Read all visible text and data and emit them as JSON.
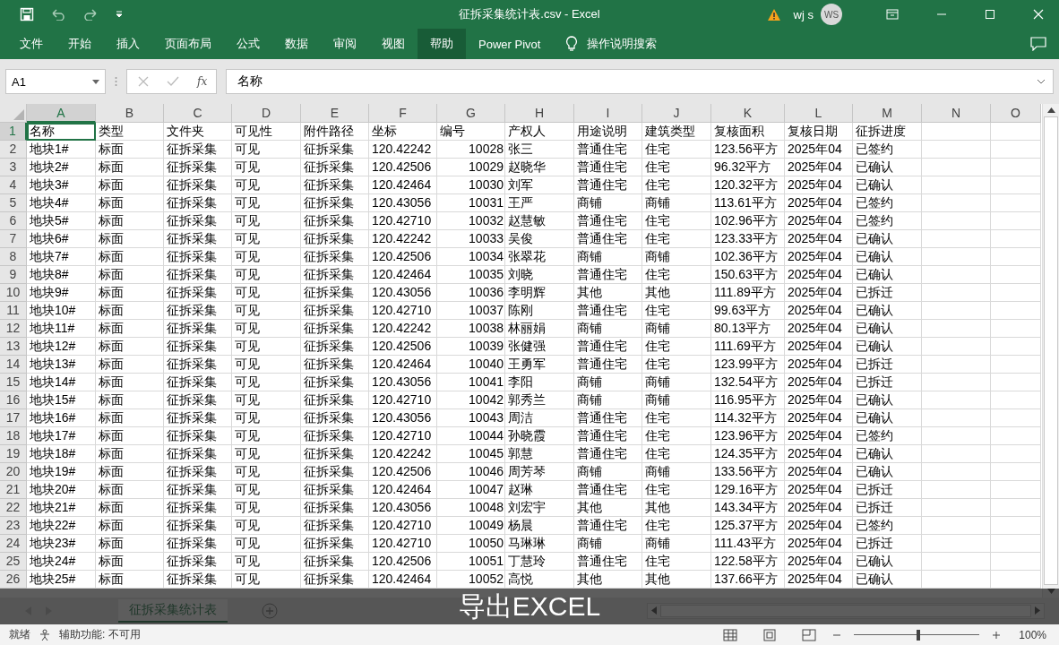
{
  "window": {
    "title": "征拆采集统计表.csv  -  Excel",
    "user": "wj s",
    "avatar": "WS"
  },
  "ribbon_tabs": [
    {
      "label": "文件",
      "selected": false
    },
    {
      "label": "开始",
      "selected": false
    },
    {
      "label": "插入",
      "selected": false
    },
    {
      "label": "页面布局",
      "selected": false
    },
    {
      "label": "公式",
      "selected": false
    },
    {
      "label": "数据",
      "selected": false
    },
    {
      "label": "审阅",
      "selected": false
    },
    {
      "label": "视图",
      "selected": false
    },
    {
      "label": "帮助",
      "selected": true
    },
    {
      "label": "Power Pivot",
      "selected": false
    }
  ],
  "tell_me": "操作说明搜索",
  "formula_bar": {
    "name_box": "A1",
    "function_button": "fx",
    "formula": "名称"
  },
  "columns": [
    {
      "letter": "A",
      "selected": true,
      "kind": "text"
    },
    {
      "letter": "B",
      "selected": false,
      "kind": "text"
    },
    {
      "letter": "C",
      "selected": false,
      "kind": "text"
    },
    {
      "letter": "D",
      "selected": false,
      "kind": "text"
    },
    {
      "letter": "E",
      "selected": false,
      "kind": "text"
    },
    {
      "letter": "F",
      "selected": false,
      "kind": "text"
    },
    {
      "letter": "G",
      "selected": false,
      "kind": "number"
    },
    {
      "letter": "H",
      "selected": false,
      "kind": "text"
    },
    {
      "letter": "I",
      "selected": false,
      "kind": "text"
    },
    {
      "letter": "J",
      "selected": false,
      "kind": "text"
    },
    {
      "letter": "K",
      "selected": false,
      "kind": "text"
    },
    {
      "letter": "L",
      "selected": false,
      "kind": "text"
    },
    {
      "letter": "M",
      "selected": false,
      "kind": "text"
    },
    {
      "letter": "N",
      "selected": false,
      "kind": "text"
    },
    {
      "letter": "O",
      "selected": false,
      "kind": "text"
    }
  ],
  "rows": [
    {
      "number": "1",
      "selected": true,
      "cells": [
        "名称",
        "类型",
        "文件夹",
        "可见性",
        "附件路径",
        "坐标",
        "编号",
        "产权人",
        "用途说明",
        "建筑类型",
        "复核面积",
        "复核日期",
        "征拆进度"
      ]
    },
    {
      "number": "2",
      "selected": false,
      "cells": [
        "地块1#",
        "标面",
        "征拆采集",
        "可见",
        "征拆采集",
        "120.42242",
        "10028",
        "张三",
        "普通住宅",
        "住宅",
        "123.56平方",
        "2025年04",
        "已签约"
      ]
    },
    {
      "number": "3",
      "selected": false,
      "cells": [
        "地块2#",
        "标面",
        "征拆采集",
        "可见",
        "征拆采集",
        "120.42506",
        "10029",
        "赵晓华",
        "普通住宅",
        "住宅",
        "96.32平方",
        "2025年04",
        "已确认"
      ]
    },
    {
      "number": "4",
      "selected": false,
      "cells": [
        "地块3#",
        "标面",
        "征拆采集",
        "可见",
        "征拆采集",
        "120.42464",
        "10030",
        "刘军",
        "普通住宅",
        "住宅",
        "120.32平方",
        "2025年04",
        "已确认"
      ]
    },
    {
      "number": "5",
      "selected": false,
      "cells": [
        "地块4#",
        "标面",
        "征拆采集",
        "可见",
        "征拆采集",
        "120.43056",
        "10031",
        "王严",
        "商铺",
        "商铺",
        "113.61平方",
        "2025年04",
        "已签约"
      ]
    },
    {
      "number": "6",
      "selected": false,
      "cells": [
        "地块5#",
        "标面",
        "征拆采集",
        "可见",
        "征拆采集",
        "120.42710",
        "10032",
        "赵慧敏",
        "普通住宅",
        "住宅",
        "102.96平方",
        "2025年04",
        "已签约"
      ]
    },
    {
      "number": "7",
      "selected": false,
      "cells": [
        "地块6#",
        "标面",
        "征拆采集",
        "可见",
        "征拆采集",
        "120.42242",
        "10033",
        "吴俊",
        "普通住宅",
        "住宅",
        "123.33平方",
        "2025年04",
        "已确认"
      ]
    },
    {
      "number": "8",
      "selected": false,
      "cells": [
        "地块7#",
        "标面",
        "征拆采集",
        "可见",
        "征拆采集",
        "120.42506",
        "10034",
        "张翠花",
        "商铺",
        "商铺",
        "102.36平方",
        "2025年04",
        "已确认"
      ]
    },
    {
      "number": "9",
      "selected": false,
      "cells": [
        "地块8#",
        "标面",
        "征拆采集",
        "可见",
        "征拆采集",
        "120.42464",
        "10035",
        "刘晓",
        "普通住宅",
        "住宅",
        "150.63平方",
        "2025年04",
        "已确认"
      ]
    },
    {
      "number": "10",
      "selected": false,
      "cells": [
        "地块9#",
        "标面",
        "征拆采集",
        "可见",
        "征拆采集",
        "120.43056",
        "10036",
        "李明辉",
        "其他",
        "其他",
        "111.89平方",
        "2025年04",
        "已拆迁"
      ]
    },
    {
      "number": "11",
      "selected": false,
      "cells": [
        "地块10#",
        "标面",
        "征拆采集",
        "可见",
        "征拆采集",
        "120.42710",
        "10037",
        "陈刚",
        "普通住宅",
        "住宅",
        "99.63平方",
        "2025年04",
        "已确认"
      ]
    },
    {
      "number": "12",
      "selected": false,
      "cells": [
        "地块11#",
        "标面",
        "征拆采集",
        "可见",
        "征拆采集",
        "120.42242",
        "10038",
        "林丽娟",
        "商铺",
        "商铺",
        "80.13平方",
        "2025年04",
        "已确认"
      ]
    },
    {
      "number": "13",
      "selected": false,
      "cells": [
        "地块12#",
        "标面",
        "征拆采集",
        "可见",
        "征拆采集",
        "120.42506",
        "10039",
        "张健强",
        "普通住宅",
        "住宅",
        "111.69平方",
        "2025年04",
        "已确认"
      ]
    },
    {
      "number": "14",
      "selected": false,
      "cells": [
        "地块13#",
        "标面",
        "征拆采集",
        "可见",
        "征拆采集",
        "120.42464",
        "10040",
        "王勇军",
        "普通住宅",
        "住宅",
        "123.99平方",
        "2025年04",
        "已拆迁"
      ]
    },
    {
      "number": "15",
      "selected": false,
      "cells": [
        "地块14#",
        "标面",
        "征拆采集",
        "可见",
        "征拆采集",
        "120.43056",
        "10041",
        "李阳",
        "商铺",
        "商铺",
        "132.54平方",
        "2025年04",
        "已拆迁"
      ]
    },
    {
      "number": "16",
      "selected": false,
      "cells": [
        "地块15#",
        "标面",
        "征拆采集",
        "可见",
        "征拆采集",
        "120.42710",
        "10042",
        "郭秀兰",
        "商铺",
        "商铺",
        "116.95平方",
        "2025年04",
        "已确认"
      ]
    },
    {
      "number": "17",
      "selected": false,
      "cells": [
        "地块16#",
        "标面",
        "征拆采集",
        "可见",
        "征拆采集",
        "120.43056",
        "10043",
        "周洁",
        "普通住宅",
        "住宅",
        "114.32平方",
        "2025年04",
        "已确认"
      ]
    },
    {
      "number": "18",
      "selected": false,
      "cells": [
        "地块17#",
        "标面",
        "征拆采集",
        "可见",
        "征拆采集",
        "120.42710",
        "10044",
        "孙晓霞",
        "普通住宅",
        "住宅",
        "123.96平方",
        "2025年04",
        "已签约"
      ]
    },
    {
      "number": "19",
      "selected": false,
      "cells": [
        "地块18#",
        "标面",
        "征拆采集",
        "可见",
        "征拆采集",
        "120.42242",
        "10045",
        "郭慧",
        "普通住宅",
        "住宅",
        "124.35平方",
        "2025年04",
        "已确认"
      ]
    },
    {
      "number": "20",
      "selected": false,
      "cells": [
        "地块19#",
        "标面",
        "征拆采集",
        "可见",
        "征拆采集",
        "120.42506",
        "10046",
        "周芳琴",
        "商铺",
        "商铺",
        "133.56平方",
        "2025年04",
        "已确认"
      ]
    },
    {
      "number": "21",
      "selected": false,
      "cells": [
        "地块20#",
        "标面",
        "征拆采集",
        "可见",
        "征拆采集",
        "120.42464",
        "10047",
        "赵琳",
        "普通住宅",
        "住宅",
        "129.16平方",
        "2025年04",
        "已拆迁"
      ]
    },
    {
      "number": "22",
      "selected": false,
      "cells": [
        "地块21#",
        "标面",
        "征拆采集",
        "可见",
        "征拆采集",
        "120.43056",
        "10048",
        "刘宏宇",
        "其他",
        "其他",
        "143.34平方",
        "2025年04",
        "已拆迁"
      ]
    },
    {
      "number": "23",
      "selected": false,
      "cells": [
        "地块22#",
        "标面",
        "征拆采集",
        "可见",
        "征拆采集",
        "120.42710",
        "10049",
        "杨晨",
        "普通住宅",
        "住宅",
        "125.37平方",
        "2025年04",
        "已签约"
      ]
    },
    {
      "number": "24",
      "selected": false,
      "cells": [
        "地块23#",
        "标面",
        "征拆采集",
        "可见",
        "征拆采集",
        "120.42710",
        "10050",
        "马琳琳",
        "商铺",
        "商铺",
        "111.43平方",
        "2025年04",
        "已拆迁"
      ]
    },
    {
      "number": "25",
      "selected": false,
      "cells": [
        "地块24#",
        "标面",
        "征拆采集",
        "可见",
        "征拆采集",
        "120.42506",
        "10051",
        "丁慧玲",
        "普通住宅",
        "住宅",
        "122.58平方",
        "2025年04",
        "已确认"
      ]
    },
    {
      "number": "26",
      "selected": false,
      "cells": [
        "地块25#",
        "标面",
        "征拆采集",
        "可见",
        "征拆采集",
        "120.42464",
        "10052",
        "高悦",
        "其他",
        "其他",
        "137.66平方",
        "2025年04",
        "已确认"
      ]
    }
  ],
  "sheet_tabs": [
    {
      "label": "征拆采集统计表",
      "selected": true
    }
  ],
  "status_bar": {
    "ready": "就绪",
    "accessibility": "辅助功能: 不可用",
    "zoom": "100%",
    "zoom_slider": {
      "level": 0.5
    }
  },
  "caption": "导出EXCEL"
}
